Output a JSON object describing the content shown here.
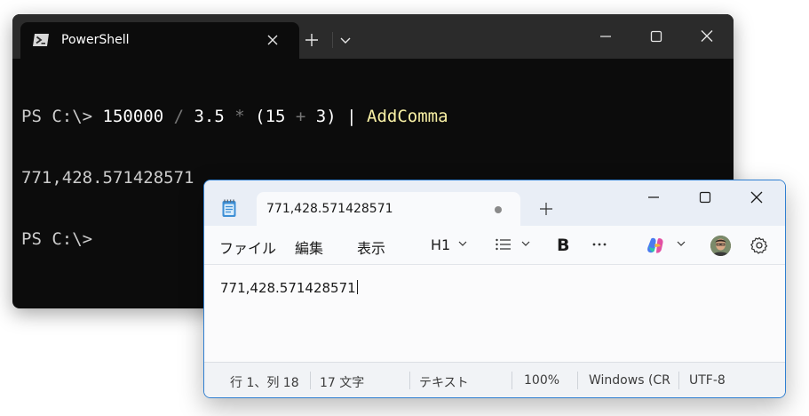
{
  "terminal": {
    "tab_title": "PowerShell",
    "icons": {
      "tab": "powershell-icon",
      "close_tab": "close-icon",
      "new_tab": "plus-icon",
      "dropdown": "chevron-down-icon",
      "minimize": "minimize-icon",
      "maximize": "maximize-icon",
      "close": "close-icon"
    },
    "line1": {
      "prompt": "PS C:\\> ",
      "num1": "150000",
      "op1": " / ",
      "num2": "3.5",
      "op2": " * ",
      "paren_open": "(15",
      "op3": " + ",
      "paren_close": "3) | ",
      "func": "AddComma"
    },
    "output": "771,428.571428571",
    "line3_prompt": "PS C:\\>",
    "colors": {
      "background": "#0c0c0c",
      "function": "#f9f1a5",
      "operator": "#767676"
    }
  },
  "notepad": {
    "tab_title": "771,428.571428571",
    "menu": {
      "file": "ファイル",
      "edit": "編集",
      "view": "表示"
    },
    "toolbar": {
      "heading": "H1",
      "bold": "B"
    },
    "icons": {
      "app": "notepad-icon",
      "unsaved": "dot-icon",
      "new_tab": "plus-icon",
      "list": "list-icon",
      "more": "more-icon",
      "copilot": "copilot-icon",
      "avatar": "avatar",
      "settings": "gear-icon"
    },
    "content": "771,428.571428571",
    "status": {
      "position": "行 1、列 18",
      "chars": "17 文字",
      "mode": "テキスト",
      "zoom": "100%",
      "line_ending": "Windows (CR",
      "encoding": "UTF-8"
    },
    "colors": {
      "accent_border": "#2f7fd1"
    }
  }
}
